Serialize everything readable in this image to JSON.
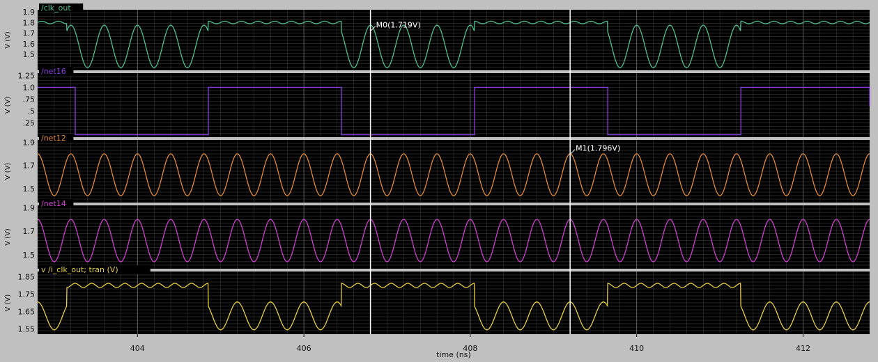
{
  "chart_data": {
    "type": "line",
    "xlabel": "time (ns)",
    "xlim": [
      402.8,
      412.8
    ],
    "xticks": [
      404,
      406,
      408,
      410,
      412
    ],
    "x_units": "ns",
    "colors": {
      "plot_bg": "#000000",
      "grid": "#6f6f6f",
      "frame_bg": "#c0c0c0",
      "marker_line": "#ffffff"
    },
    "markers": [
      {
        "name": "M0",
        "label": "M0(1.719V)",
        "x": 406.8,
        "trace": 0,
        "value": 1.719
      },
      {
        "name": "M1",
        "label": "M1(1.796V)",
        "x": 409.2,
        "trace": 2,
        "value": 1.796
      }
    ],
    "panels": [
      {
        "name": "/clk_out",
        "color": "#4fc08d",
        "ylabel": "V (V)",
        "ylim": [
          1.35,
          1.92
        ],
        "yticks": [
          "1.9",
          "1.8",
          "1.7",
          "1.6",
          "1.5"
        ],
        "ytick_values": [
          1.9,
          1.8,
          1.7,
          1.6,
          1.5
        ],
        "signal": "gated",
        "gate_windows": [
          [
            403.15,
            404.85
          ],
          [
            406.45,
            408.05
          ],
          [
            409.65,
            411.25
          ]
        ],
        "high_level": 1.8,
        "osc_center": 1.575,
        "osc_amplitude": 0.2,
        "period_ns": 0.4
      },
      {
        "name": "/net16",
        "color": "#8a3fe0",
        "ylabel": "V (V)",
        "ylim": [
          -0.05,
          1.3
        ],
        "yticks": [
          "1.25",
          "1.0",
          ".75",
          ".5",
          ".25"
        ],
        "ytick_values": [
          1.25,
          1.0,
          0.75,
          0.5,
          0.25
        ],
        "signal": "square",
        "transitions": [
          {
            "x": 403.25,
            "level": 0.0
          },
          {
            "x": 404.85,
            "level": 1.0
          },
          {
            "x": 406.45,
            "level": 0.0
          },
          {
            "x": 408.05,
            "level": 1.0
          },
          {
            "x": 409.65,
            "level": 0.0
          },
          {
            "x": 411.25,
            "level": 1.0
          },
          {
            "x": 412.8,
            "level": 0.6
          }
        ],
        "initial_level": 1.0
      },
      {
        "name": "/net12",
        "color": "#e08a3a",
        "ylabel": "V (V)",
        "ylim": [
          1.38,
          1.92
        ],
        "yticks": [
          "1.9",
          "1.7",
          "1.5"
        ],
        "ytick_values": [
          1.9,
          1.7,
          1.5
        ],
        "signal": "sine",
        "osc_center": 1.62,
        "osc_amplitude": 0.18,
        "period_ns": 0.4
      },
      {
        "name": "/net14",
        "color": "#d040d0",
        "ylabel": "V (V)",
        "ylim": [
          1.38,
          1.92
        ],
        "yticks": [
          "1.9",
          "1.7",
          "1.5"
        ],
        "ytick_values": [
          1.9,
          1.7,
          1.5
        ],
        "signal": "sine",
        "osc_center": 1.62,
        "osc_amplitude": 0.18,
        "period_ns": 0.4
      },
      {
        "name": "v /i_clk_out; tran (V)",
        "color": "#e8d040",
        "ylabel": "V (V)",
        "ylim": [
          1.52,
          1.88
        ],
        "yticks": [
          "1.85",
          "1.75",
          "1.65",
          "1.55"
        ],
        "ytick_values": [
          1.85,
          1.75,
          1.65,
          1.55
        ],
        "signal": "gated",
        "gate_windows": [
          [
            403.15,
            404.85
          ],
          [
            406.45,
            408.05
          ],
          [
            409.65,
            411.25
          ]
        ],
        "invert": true,
        "high_level": 1.8,
        "osc_center": 1.625,
        "osc_amplitude": 0.08,
        "period_ns": 0.4
      }
    ]
  }
}
